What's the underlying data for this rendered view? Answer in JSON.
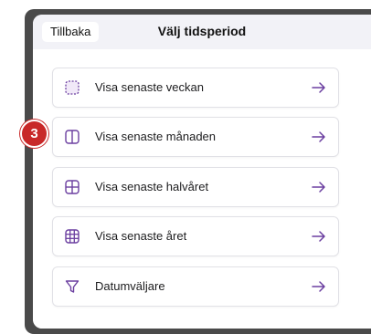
{
  "header": {
    "back_label": "Tillbaka",
    "title": "Välj tidsperiod"
  },
  "options": [
    {
      "label": "Visa senaste veckan",
      "icon": "week-icon"
    },
    {
      "label": "Visa senaste månaden",
      "icon": "month-icon"
    },
    {
      "label": "Visa senaste halvåret",
      "icon": "half-year-icon"
    },
    {
      "label": "Visa senaste året",
      "icon": "year-icon"
    },
    {
      "label": "Datumväljare",
      "icon": "filter-icon"
    }
  ],
  "annotation": {
    "step_number": "3"
  },
  "colors": {
    "accent": "#6b3fa0",
    "badge": "#c82828",
    "bezel": "#4a4a4a",
    "background": "#f2f2f7"
  }
}
